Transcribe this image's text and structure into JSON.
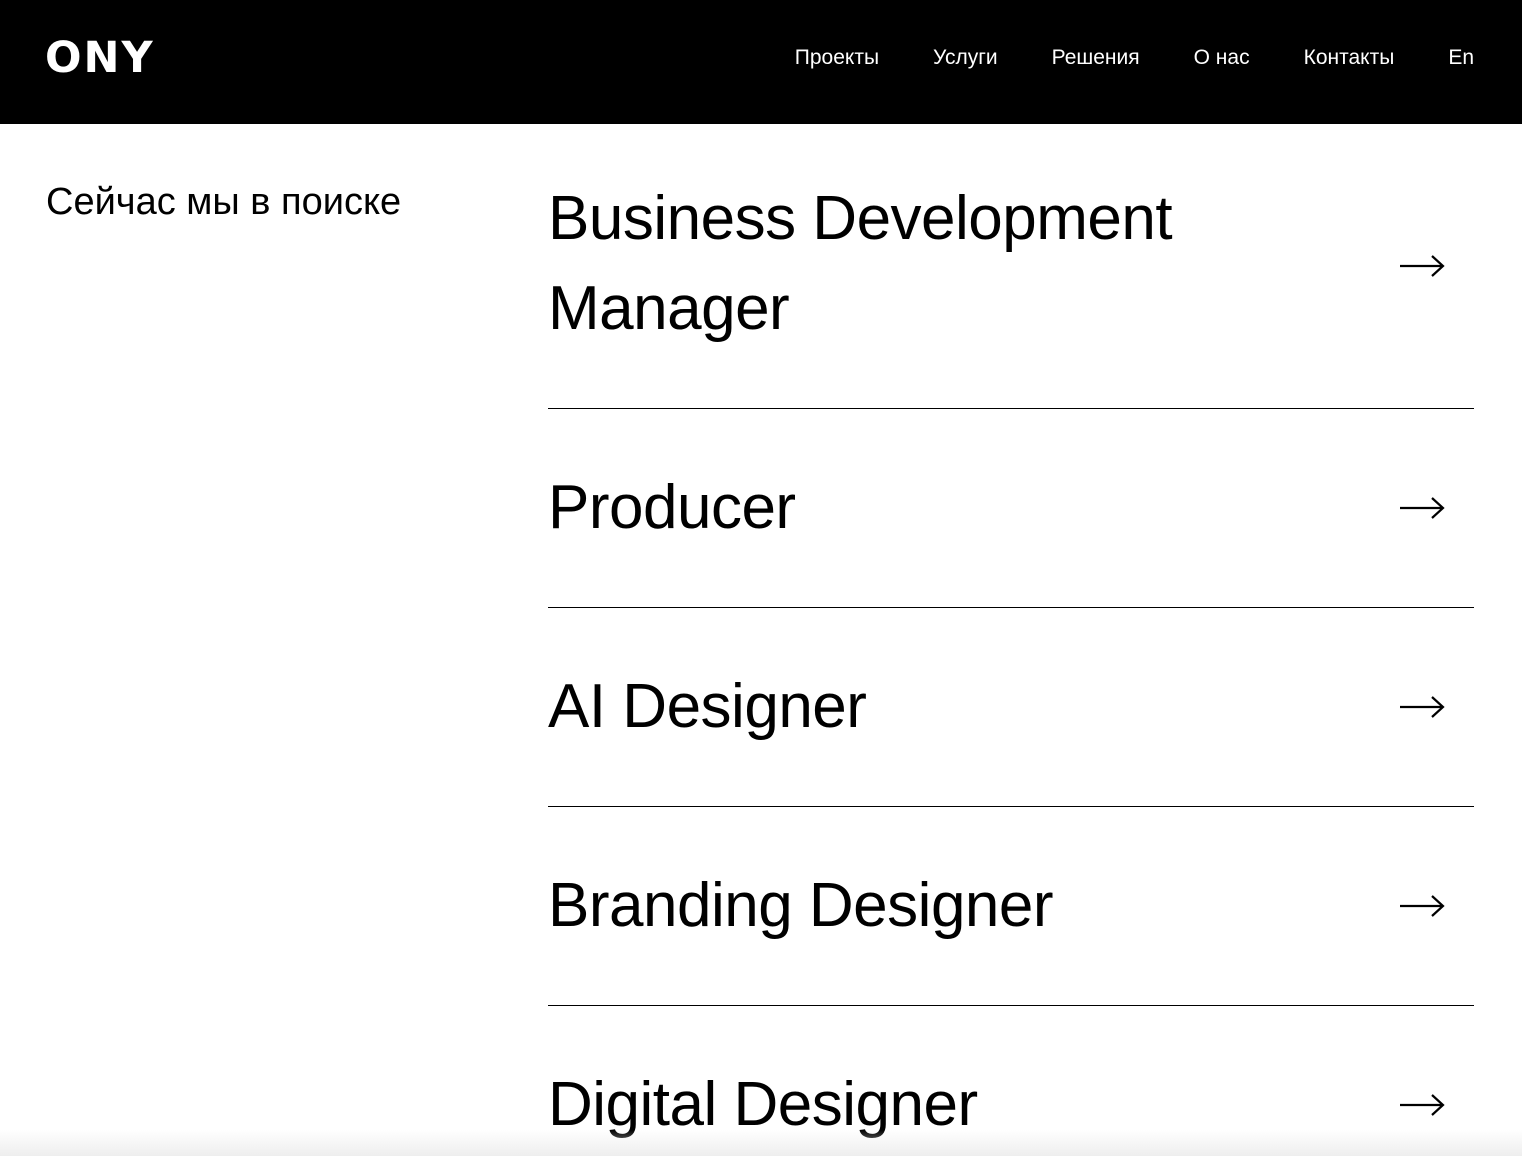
{
  "header": {
    "logo": "ONY",
    "nav": [
      {
        "label": "Проекты"
      },
      {
        "label": "Услуги"
      },
      {
        "label": "Решения"
      },
      {
        "label": "О нас"
      },
      {
        "label": "Контакты"
      },
      {
        "label": "En"
      }
    ]
  },
  "main": {
    "section_title": "Сейчас мы в поиске",
    "jobs": [
      {
        "title": "Business Development Manager",
        "arrow_icon": "arrow-right-icon"
      },
      {
        "title": "Producer",
        "arrow_icon": "arrow-right-icon"
      },
      {
        "title": "AI Designer",
        "arrow_icon": "arrow-right-icon"
      },
      {
        "title": "Branding Designer",
        "arrow_icon": "arrow-right-icon"
      },
      {
        "title": "Digital Designer",
        "arrow_icon": "arrow-right-icon"
      }
    ]
  },
  "colors": {
    "header_bg": "#000000",
    "header_text": "#ffffff",
    "page_bg": "#ffffff",
    "text": "#000000",
    "divider": "#000000"
  }
}
